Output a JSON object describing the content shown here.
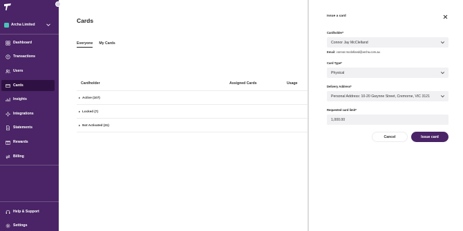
{
  "sidebar": {
    "org_name": "Archa Limited",
    "items": [
      {
        "label": "Dashboard",
        "icon": "dashboard-icon"
      },
      {
        "label": "Transactions",
        "icon": "transactions-icon"
      },
      {
        "label": "Users",
        "icon": "users-icon"
      },
      {
        "label": "Cards",
        "icon": "card-icon",
        "active": true
      },
      {
        "label": "Insights",
        "icon": "insights-icon"
      },
      {
        "label": "Integrations",
        "icon": "integrations-icon"
      },
      {
        "label": "Statements",
        "icon": "statements-icon"
      },
      {
        "label": "Rewards",
        "icon": "rewards-icon"
      },
      {
        "label": "Billing",
        "icon": "billing-icon"
      }
    ],
    "bottom_items": [
      {
        "label": "Help & Support",
        "icon": "help-icon"
      },
      {
        "label": "Settings",
        "icon": "settings-icon"
      }
    ]
  },
  "main": {
    "title": "Cards",
    "tabs": [
      {
        "label": "Everyone",
        "active": true
      },
      {
        "label": "My Cards",
        "active": false
      }
    ],
    "table_headers": [
      "Cardholder",
      "Assigned Cards",
      "Usage"
    ],
    "groups": [
      {
        "label": "Active (107)"
      },
      {
        "label": "Locked (7)"
      },
      {
        "label": "Not Activated (31)"
      }
    ]
  },
  "panel": {
    "title": "Issue a card",
    "cardholder_label": "Cardholder*",
    "cardholder_value": "Connor Jay McClelland",
    "email_label": "Email:",
    "email_value": "connor.mcclelland@archa.com.au",
    "card_type_label": "Card Type*",
    "card_type_value": "Physical",
    "delivery_label": "Delivery Address*",
    "delivery_value": "Personal Address: 10-20 Gwynne Street, Cremorne, VIC 3121",
    "limit_label": "Requested card limit*",
    "limit_value": "1,000.00",
    "cancel_label": "Cancel",
    "issue_label": "Issue card"
  },
  "colors": {
    "sidebar_bg": "#4a2466",
    "sidebar_active": "#2e1142",
    "primary_button": "#4a2466",
    "org_badge": "#49c2b9"
  }
}
